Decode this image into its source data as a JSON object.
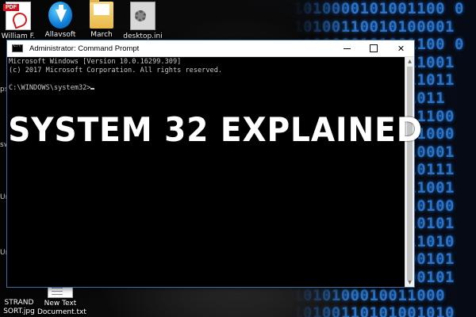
{
  "desktop": {
    "icons": [
      {
        "label": "William F.",
        "label2": "C",
        "icon": "pdf-file-icon"
      },
      {
        "label": "Allavsoft",
        "icon": "allavsoft-app-icon"
      },
      {
        "label": "March",
        "icon": "folder-icon"
      },
      {
        "label": "desktop.ini",
        "icon": "settings-file-icon"
      },
      {
        "label": "STRAND",
        "label2": "SORT.jpg",
        "icon": "image-file-icon"
      },
      {
        "label": "New Text",
        "label2": "Document.txt",
        "icon": "text-file-icon"
      }
    ],
    "edge_labels": [
      "ps",
      "sw",
      "Un",
      "Un"
    ],
    "binary_rows": [
      "1010000101001100 0",
      "10100110010100001",
      "0100000101001100 0",
      "10000010100011001",
      "01001011010011011",
      "0100110100001011",
      "00110001001011100",
      "10100101011011000",
      "01110001100110001",
      "00001011000010111",
      "10100010100111001",
      "01000110100110100",
      "00100011010010101",
      "10101100011011010",
      "10100010100100101",
      "11011010101000101",
      "1010100010011000",
      "10100110101001010"
    ]
  },
  "cmd_window": {
    "title": "Administrator: Command Prompt",
    "buttons": {
      "close": "✕"
    },
    "console_lines": [
      "Microsoft Windows [Version 10.0.16299.309]",
      "(c) 2017 Microsoft Corporation. All rights reserved.",
      "",
      "C:\\WINDOWS\\system32>"
    ],
    "scroll_up": "▲",
    "scroll_down": "▼"
  },
  "headline": "SYSTEM 32 EXPLAINED",
  "colors": {
    "binary_blue": "#2a73c9",
    "console_text": "#c8c8c8",
    "titlebar": "#ffffff"
  }
}
